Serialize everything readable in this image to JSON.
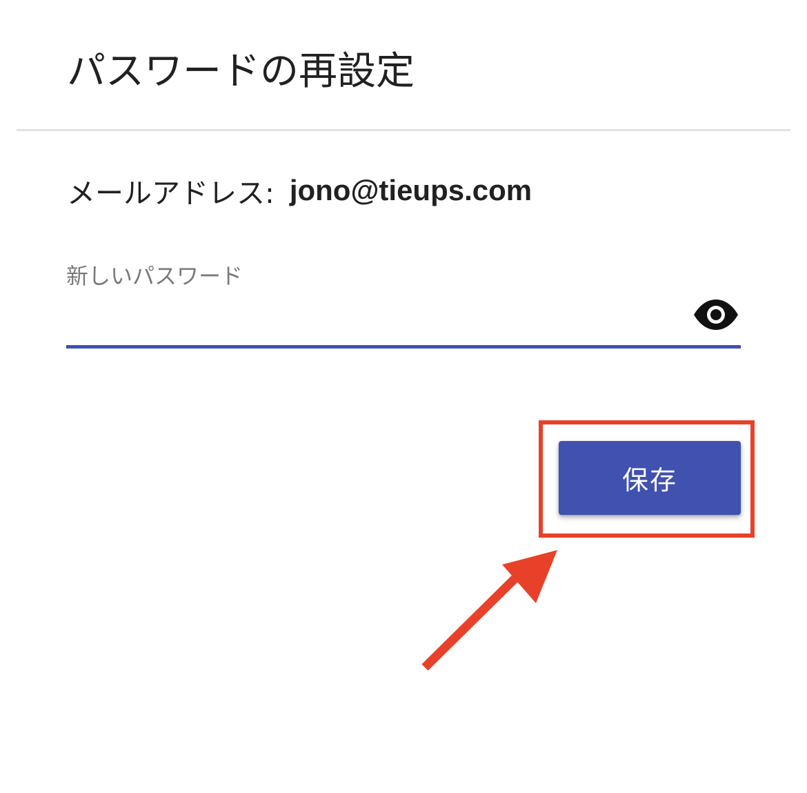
{
  "dialog": {
    "title": "パスワードの再設定"
  },
  "account": {
    "email_label": "メールアドレス:",
    "email_value": "jono@tieups.com"
  },
  "password_field": {
    "label": "新しいパスワード",
    "value": "",
    "toggle_icon": "eye-icon"
  },
  "actions": {
    "save_label": "保存"
  },
  "colors": {
    "accent": "#3f51b5",
    "button": "#4051b0",
    "annotation": "#e8412a",
    "divider": "#e2e2e2"
  }
}
